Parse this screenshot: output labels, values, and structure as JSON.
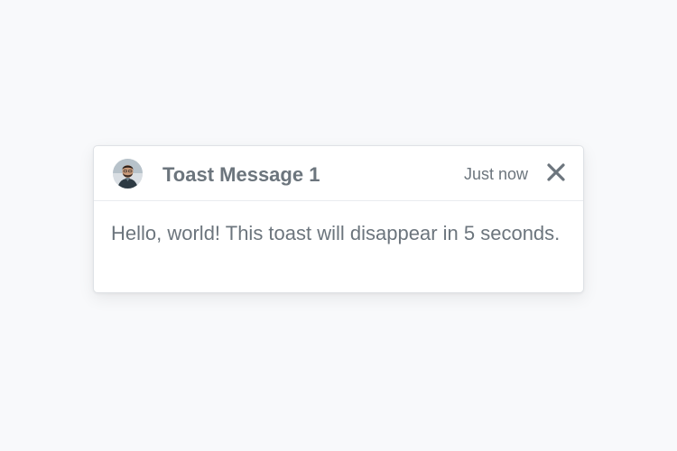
{
  "toast": {
    "avatar_icon": "user-avatar",
    "title": "Toast Message 1",
    "time": "Just now",
    "close_icon": "close-icon",
    "body": "Hello, world! This toast will disappear in 5 seconds."
  },
  "colors": {
    "background": "#f8f9fb",
    "toast_background": "#ffffff",
    "text_muted": "#6c757d",
    "border": "#dfe2e6"
  }
}
